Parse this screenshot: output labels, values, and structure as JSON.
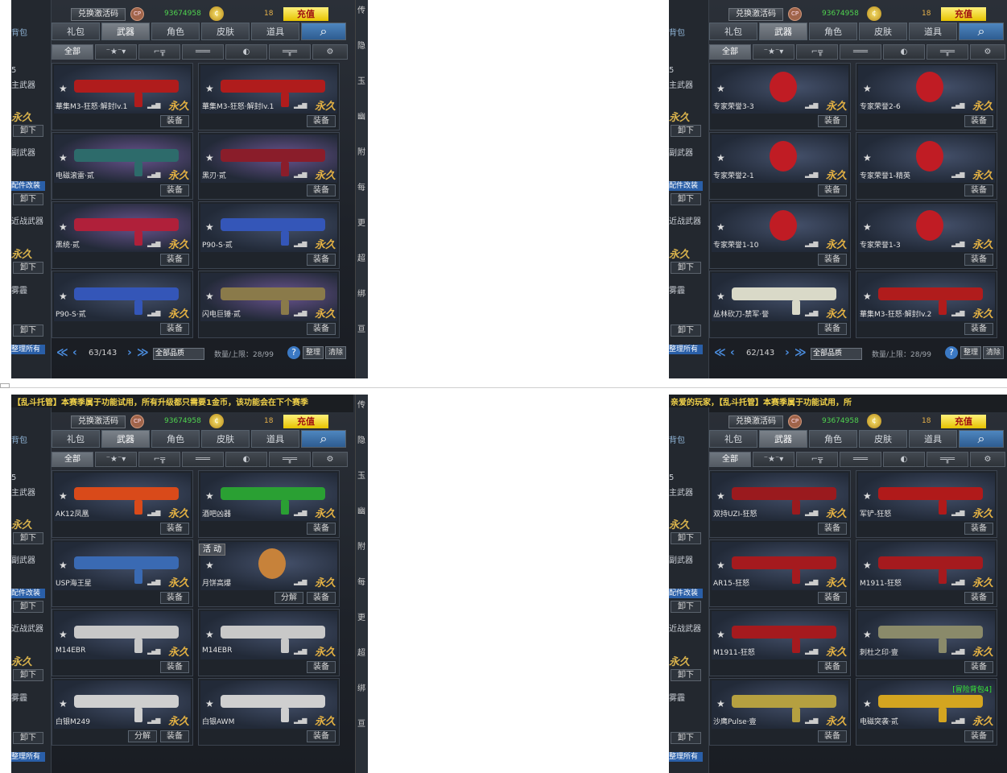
{
  "common": {
    "redeem": "兑换激活码",
    "cp_badge": "CP",
    "cp_value": "93674958",
    "coin_value": "18",
    "charge": "充值",
    "tabs": [
      "礼包",
      "武器",
      "角色",
      "皮肤",
      "道具"
    ],
    "search": "⌕",
    "subtabs": [
      "全部",
      "⁻★⁻▾",
      "⌐╦",
      "═══",
      "◐",
      "═╦═",
      "⚙"
    ],
    "equip": "装备",
    "perm": "永久",
    "star": "★",
    "signal": "▂▄▆",
    "quality": "全部品质",
    "capacity": "数量/上限：28/99",
    "help": "?",
    "sort": "整理",
    "clear": "清除",
    "first": "≪",
    "prev": "‹",
    "next": "›",
    "last": "≫",
    "left": {
      "bag": "背包",
      "slot": "5",
      "primary": "主武器",
      "secondary": "副武器",
      "melee": "近战武器",
      "special": "雾霾",
      "unequip": "卸下",
      "perm": "永久",
      "mod": "配件改装",
      "sortall": "整理所有"
    },
    "strip": [
      "传",
      "隐",
      "玉",
      "幽",
      "附",
      "每",
      "更",
      "超",
      "绑",
      "亘"
    ]
  },
  "panels": [
    {
      "id": "top-left",
      "page": "63/143",
      "marquee": "",
      "items": [
        {
          "name": "華集M3-狂怒·解封lv.1",
          "color": "#b01c1c"
        },
        {
          "name": "華集M3-狂怒·解封lv.1",
          "color": "#b01c1c"
        },
        {
          "name": "电磁滚雷·贰",
          "color": "#2d6b6b",
          "purple": true
        },
        {
          "name": "黑刃·贰",
          "color": "#8a1d2a",
          "purple": true
        },
        {
          "name": "黑统·贰",
          "color": "#b0203a",
          "purple": true
        },
        {
          "name": "P90-S·贰",
          "color": "#3456b8"
        },
        {
          "name": "P90-S·贰",
          "color": "#3456b8"
        },
        {
          "name": "闪电巨锤·贰",
          "color": "#8a7a4a",
          "purple": true
        }
      ]
    },
    {
      "id": "top-right",
      "page": "62/143",
      "marquee": "",
      "items": [
        {
          "name": "专家荣誉3-3",
          "color": "#c01c24",
          "round": true
        },
        {
          "name": "专家荣誉2-6",
          "color": "#c01c24",
          "round": true
        },
        {
          "name": "专家荣誉2-1",
          "color": "#c01c24",
          "round": true
        },
        {
          "name": "专家荣誉1-精英",
          "color": "#c01c24",
          "round": true
        },
        {
          "name": "专家荣誉1-10",
          "color": "#c01c24",
          "round": true
        },
        {
          "name": "专家荣誉1-3",
          "color": "#c01c24",
          "round": true
        },
        {
          "name": "丛林砍刀-禁军·誉",
          "color": "#d9d9c8"
        },
        {
          "name": "華集M3-狂怒·解封lv.2",
          "color": "#b01c1c"
        }
      ]
    },
    {
      "id": "bottom-left",
      "page": "",
      "marquee": "【乱斗托管】本赛季属于功能试用，所有升级都只需要1金币，该功能会在下个赛季",
      "items": [
        {
          "name": "AK12凤凰",
          "color": "#d94a1a"
        },
        {
          "name": "酒吧凶器",
          "color": "#2aa033"
        },
        {
          "name": "USP海王星",
          "color": "#3a6ab3"
        },
        {
          "name": "月饼高爆",
          "color": "#c7823a",
          "round": true,
          "event": "活 动",
          "decompose": "分解"
        },
        {
          "name": "M14EBR",
          "color": "#c8c8c8"
        },
        {
          "name": "M14EBR",
          "color": "#c8c8c8"
        },
        {
          "name": "白银M249",
          "color": "#cfcfcf",
          "decompose": "分解"
        },
        {
          "name": "白银AWM",
          "color": "#cfcfcf"
        }
      ]
    },
    {
      "id": "bottom-right",
      "page": "",
      "marquee": "亲爱的玩家，【乱斗托管】本赛季属于功能试用，所",
      "items": [
        {
          "name": "双持UZI-狂怒",
          "color": "#9a1a1e"
        },
        {
          "name": "军铲-狂怒",
          "color": "#b01a1a"
        },
        {
          "name": "AR15-狂怒",
          "color": "#a51a1e"
        },
        {
          "name": "M1911-狂怒",
          "color": "#a51a1e"
        },
        {
          "name": "M1911-狂怒",
          "color": "#a51a1e"
        },
        {
          "name": "刺杜之印·壹",
          "color": "#8a8a6a"
        },
        {
          "name": "沙鹰Pulse·壹",
          "color": "#b5a040"
        },
        {
          "name": "电磁突袭·贰",
          "color": "#d4a520",
          "tag": "[冒险背包4]"
        }
      ]
    }
  ]
}
